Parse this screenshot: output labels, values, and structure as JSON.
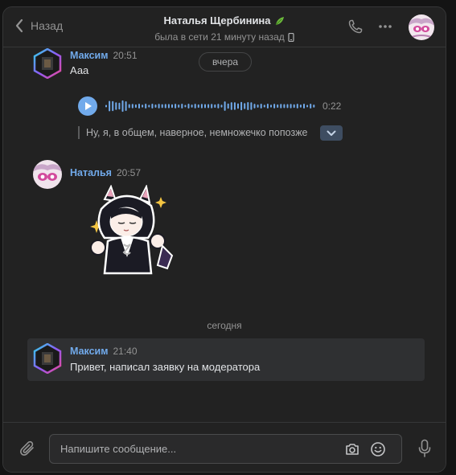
{
  "header": {
    "back_label": "Назад",
    "peer_name": "Наталья Щербинина",
    "peer_status": "была в сети 21 минуту назад"
  },
  "feed": {
    "date_yesterday": "вчера",
    "date_today": "сегодня",
    "messages": [
      {
        "author": "Максим",
        "time": "20:51",
        "text": "Ааа",
        "voice_duration": "0:22",
        "transcript": "Ну, я, в общем, наверное, немножечко попозже"
      },
      {
        "author": "Наталья",
        "time": "20:57"
      },
      {
        "author": "Максим",
        "time": "21:40",
        "text": "Привет, написал заявку на модератора"
      }
    ]
  },
  "composer": {
    "placeholder": "Напишите сообщение..."
  },
  "colors": {
    "accent": "#71aaeb",
    "window_bg": "#222222",
    "highlight_bg": "#2f3032"
  },
  "icons": [
    "back-icon",
    "leaf-emoji-icon",
    "mobile-icon",
    "phone-icon",
    "more-icon",
    "play-icon",
    "chevron-down-icon",
    "paperclip-icon",
    "camera-icon",
    "smile-icon",
    "mic-icon"
  ]
}
